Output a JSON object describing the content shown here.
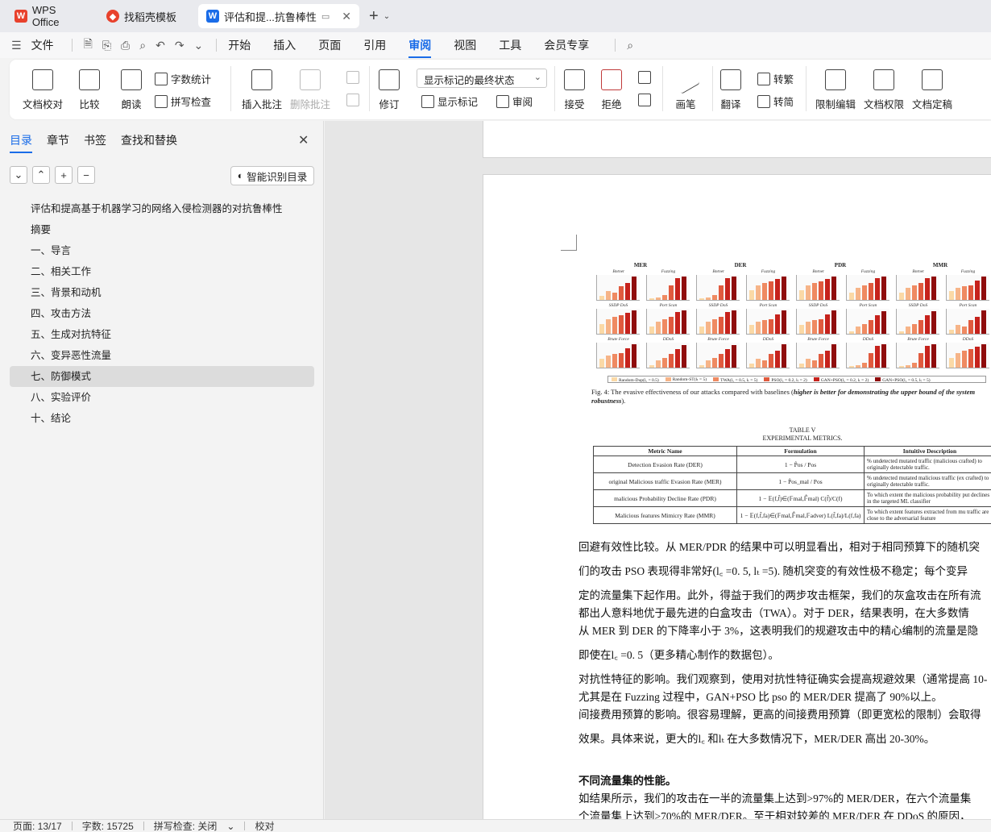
{
  "tabs": [
    {
      "label": "WPS Office",
      "icon": "wps-logo-icon",
      "color": "#e8412c"
    },
    {
      "label": "找稻壳模板",
      "icon": "docer-logo-icon",
      "color": "#e8412c"
    },
    {
      "label": "评估和提...抗鲁棒性",
      "icon": "word-doc-icon",
      "color": "#1a6ce8"
    }
  ],
  "menu": {
    "file": "文件",
    "items": [
      "开始",
      "插入",
      "页面",
      "引用",
      "审阅",
      "视图",
      "工具",
      "会员专享"
    ],
    "active": "审阅"
  },
  "ribbon": {
    "doc_check": "文档校对",
    "compare": "比较",
    "read_aloud": "朗读",
    "word_count": "字数统计",
    "spell_check": "拼写检查",
    "insert_comment": "插入批注",
    "delete_comment": "删除批注",
    "revise": "修订",
    "markup_state": "显示标记的最终状态",
    "show_markup": "显示标记",
    "review_pane": "审阅",
    "accept": "接受",
    "reject": "拒绝",
    "pen": "画笔",
    "translate": "翻译",
    "to_traditional": "转繁",
    "to_simplified": "转简",
    "restrict_edit": "限制编辑",
    "doc_permission": "文档权限",
    "doc_finalize": "文档定稿"
  },
  "sidebar": {
    "tabs": [
      "目录",
      "章节",
      "书签",
      "查找和替换"
    ],
    "active_tab": "目录",
    "smart_toc": "智能识别目录",
    "toc": [
      {
        "label": "评估和提高基于机器学习的网络入侵检测器的对抗鲁棒性",
        "active": false
      },
      {
        "label": "摘要",
        "active": false
      },
      {
        "label": "一、导言",
        "active": false
      },
      {
        "label": "二、相关工作",
        "active": false
      },
      {
        "label": "三、背景和动机",
        "active": false
      },
      {
        "label": "四、攻击方法",
        "active": false
      },
      {
        "label": "五、生成对抗特征",
        "active": false
      },
      {
        "label": "六、变异恶性流量",
        "active": false
      },
      {
        "label": "七、防御模式",
        "active": true
      },
      {
        "label": "八、实验评价",
        "active": false
      },
      {
        "label": "十、结论",
        "active": false
      }
    ]
  },
  "document": {
    "figure": {
      "groups": [
        "MER",
        "DER",
        "PDR",
        "MMR"
      ],
      "cells": [
        "Botnet",
        "Fuzzing",
        "SSDP DoS",
        "Port Scan",
        "Brute Force",
        "DDoS"
      ],
      "yticks": [
        "1.00",
        "0.75",
        "0.50",
        "0.25",
        "0.00"
      ],
      "legend": [
        {
          "label": "Random-Dup(l꜀ = 0.5)",
          "color": "#fbd9a6"
        },
        {
          "label": "Random-ST(lₜ = 5)",
          "color": "#f6b488"
        },
        {
          "label": "TWA(l꜀ = 0.5, lₜ = 5)",
          "color": "#ef8a62"
        },
        {
          "label": "PSO(l꜀ = 0.2, lₜ = 2)",
          "color": "#e05a3e"
        },
        {
          "label": "GAN+PSO(l꜀ = 0.2, lₜ = 2)",
          "color": "#c6221c"
        },
        {
          "label": "GAN+PSO(l꜀ = 0.5, lₜ = 5)",
          "color": "#8f0c0c"
        }
      ],
      "caption_plain": "Fig. 4: The evasive effectiveness of our attacks compared with baselines (",
      "caption_bold": "higher is better for demonstrating the upper bound of the system robustness",
      "caption_end": ")."
    },
    "table": {
      "title": "TABLE V",
      "subtitle": "EXPERIMENTAL METRICS.",
      "headers": [
        "Metric Name",
        "Formulation",
        "Intuitive Description"
      ],
      "rows": [
        {
          "name": "Detection Evasion Rate (DER)",
          "formula": "1 − P̂os / Pos",
          "desc": "% undetected mutated traffic (malicious crafted) to originally detectable traffic."
        },
        {
          "name": "original Malicious traffic Evasion Rate (MER)",
          "formula": "1 − P̂os_mal / Pos",
          "desc": "% undetected mutated malicious traffic (ex crafted) to originally detectable traffic."
        },
        {
          "name": "malicious Probability Decline Rate (PDR)",
          "formula": "1 − 𝔼(f,f̂)∈(𝔽mal,𝔽̂mal) C(f̂)/C(f)",
          "desc": "To which extent the malicious probability put declines in the targeted ML classifier"
        },
        {
          "name": "Malicious features Mimicry Rate (MMR)",
          "formula": "1 − 𝔼(f,f̂,fa)∈(𝔽mal,𝔽̂mal,𝔽adver) L(f̂,fa)/L(f,fa)",
          "desc": "To which extent features extracted from mu traffic are close to the adversarial feature"
        }
      ]
    },
    "paragraphs": [
      "回避有效性比较。从 MER/PDR 的结果中可以明显看出，相对于相同预算下的随机突",
      "们的攻击 PSO 表现得非常好(l꜀ =0. 5,  lₜ =5). 随机突变的有效性极不稳定；每个变异",
      "定的流量集下起作用。此外，得益于我们的两步攻击框架，我们的灰盒攻击在所有流",
      "都出人意料地优于最先进的白盒攻击（TWA）。对于 DER，结果表明，在大多数情",
      "从 MER 到 DER 的下降率小于 3%，这表明我们的规避攻击中的精心编制的流量是隐",
      "即使在l꜀ =0. 5（更多精心制作的数据包）。",
      "对抗性特征的影响。我们观察到，使用对抗性特征确实会提高规避效果（通常提高 10-",
      "尤其是在 Fuzzing 过程中，GAN+PSO 比 pso 的 MER/DER 提高了 90%以上。",
      "间接费用预算的影响。很容易理解，更高的间接费用预算（即更宽松的限制）会取得",
      "效果。具体来说，更大的l꜀ 和lₜ 在大多数情况下，MER/DER 高出 20-30%。",
      "不同流量集的性能。",
      "如结果所示，我们的攻击在一半的流量集上达到>97%的 MER/DER，在六个流量集",
      "个流量集上达到>70%的 MER/DER。至于相对较差的 MER/DER 在 DDoS 的原因，"
    ]
  },
  "status": {
    "page": "页面: 13/17",
    "words": "字数: 15725",
    "spell": "拼写检查: 关闭",
    "proof": "校对"
  }
}
